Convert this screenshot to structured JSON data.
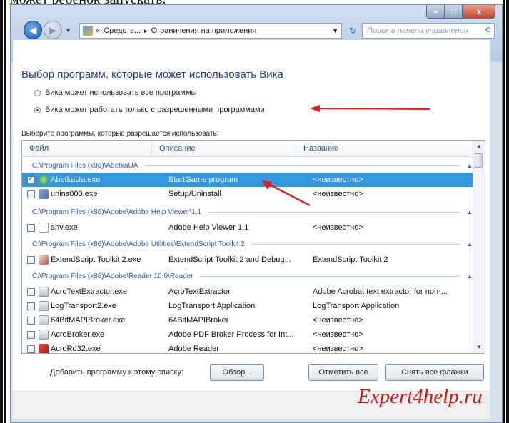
{
  "page_top_text": "может ребёнок запускать.",
  "window": {
    "controls": {
      "minimize": "–",
      "maximize": "□",
      "close": "x"
    }
  },
  "nav": {
    "address": {
      "chevron": "«",
      "seg1": "Средств...",
      "sep": "▸",
      "seg2": "Ограничения на приложения"
    },
    "search_placeholder": "Поиск в панели управления"
  },
  "heading": "Выбор программ, которые может использовать Вика",
  "radios": [
    {
      "label": "Вика может использовать все программы",
      "selected": false
    },
    {
      "label": "Вика может работать только с разрешенными программами",
      "selected": true
    }
  ],
  "list_label": "Выберите программы, которые разрешается использовать:",
  "columns": [
    "Файл",
    "Описание",
    "Название"
  ],
  "groups": [
    {
      "path": "C:\\Program Files (x86)\\AbetkaUA",
      "items": [
        {
          "file": "AbetkaUa.exe",
          "desc": "StartGame program",
          "name": "<неизвестно>",
          "checked": true,
          "selected": true
        },
        {
          "file": "unins000.exe",
          "desc": "Setup/Uninstall",
          "name": "<неизвестно>",
          "checked": false,
          "selected": false
        }
      ]
    },
    {
      "path": "C:\\Program Files (x86)\\Adobe\\Adobe Help Viewer\\1.1",
      "items": [
        {
          "file": "ahv.exe",
          "desc": "Adobe Help Viewer 1.1",
          "name": "<неизвестно>",
          "checked": false,
          "selected": false
        }
      ]
    },
    {
      "path": "C:\\Program Files (x86)\\Adobe\\Adobe Utilities\\ExtendScript Toolkit 2",
      "items": [
        {
          "file": "ExtendScript Toolkit 2.exe",
          "desc": "ExtendScript Toolkit 2 and Debug...",
          "name": "ExtendScript Toolkit 2",
          "checked": false,
          "selected": false
        }
      ]
    },
    {
      "path": "C:\\Program Files (x86)\\Adobe\\Reader 10.0\\Reader",
      "items": [
        {
          "file": "AcroTextExtractor.exe",
          "desc": "AcroTextExtractor",
          "name": "Adobe Acrobat text extractor for non-...",
          "checked": false,
          "selected": false
        },
        {
          "file": "LogTransport2.exe",
          "desc": "LogTransport Application",
          "name": "LogTransport Application",
          "checked": false,
          "selected": false
        },
        {
          "file": "64BitMAPIBroker.exe",
          "desc": "64BitMAPIBroker",
          "name": "<неизвестно>",
          "checked": false,
          "selected": false
        },
        {
          "file": "AcroBroker.exe",
          "desc": "Adobe PDF Broker Process for Int...",
          "name": "<неизвестно>",
          "checked": false,
          "selected": false
        },
        {
          "file": "AcroRd32.exe",
          "desc": "Adobe Reader",
          "name": "<неизвестно>",
          "checked": false,
          "selected": false
        }
      ]
    }
  ],
  "add_label": "Добавить программу к этому списку:",
  "buttons": {
    "browse": "Обзор...",
    "check_all": "Отметить все",
    "uncheck_all": "Снять все флажки"
  },
  "watermark": "Expert4help.ru",
  "colors": {
    "selection": "#3298e0",
    "heading": "#1e3f8c",
    "arrow": "#e02020",
    "watermark": "#c81c1c"
  }
}
